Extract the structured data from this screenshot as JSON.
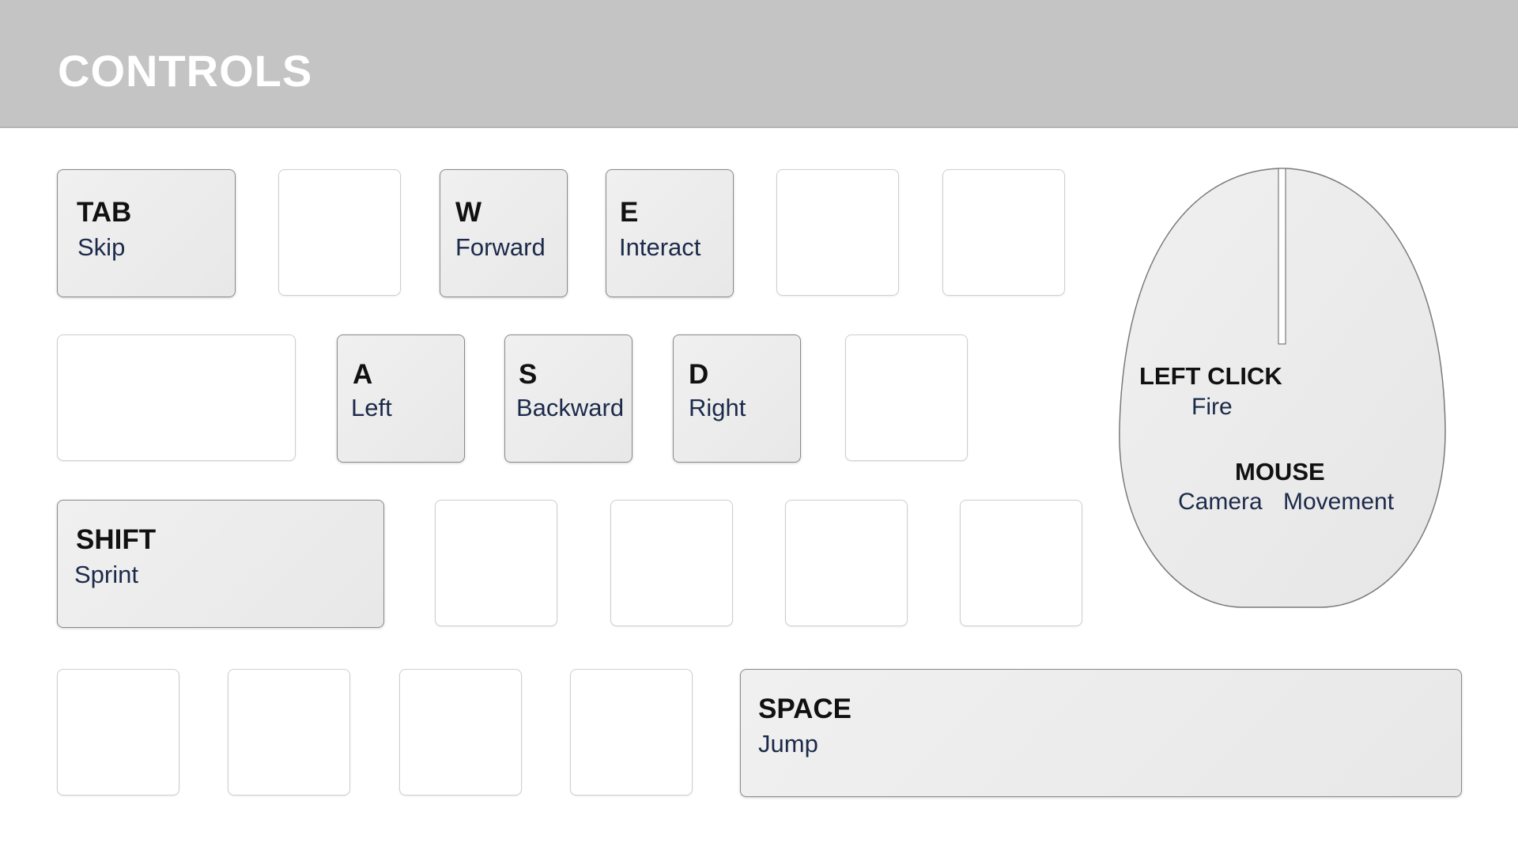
{
  "header": {
    "title": "CONTROLS"
  },
  "keys": {
    "tab": {
      "key": "TAB",
      "action": "Skip"
    },
    "w": {
      "key": "W",
      "action": "Forward"
    },
    "e": {
      "key": "E",
      "action": "Interact"
    },
    "a": {
      "key": "A",
      "action": "Left"
    },
    "s": {
      "key": "S",
      "action": "Backward"
    },
    "d": {
      "key": "D",
      "action": "Right"
    },
    "shift": {
      "key": "SHIFT",
      "action": "Sprint"
    },
    "space": {
      "key": "SPACE",
      "action": "Jump"
    }
  },
  "mouse": {
    "left_click_label": "LEFT CLICK",
    "left_click_action": "Fire",
    "mouse_label": "MOUSE",
    "mouse_action_1": "Camera",
    "mouse_action_2": "Movement"
  },
  "colors": {
    "header_bg": "#c4c4c4",
    "header_text": "#ffffff",
    "key_bound_bg": "#ececec",
    "action_text": "#1c2a4a"
  }
}
